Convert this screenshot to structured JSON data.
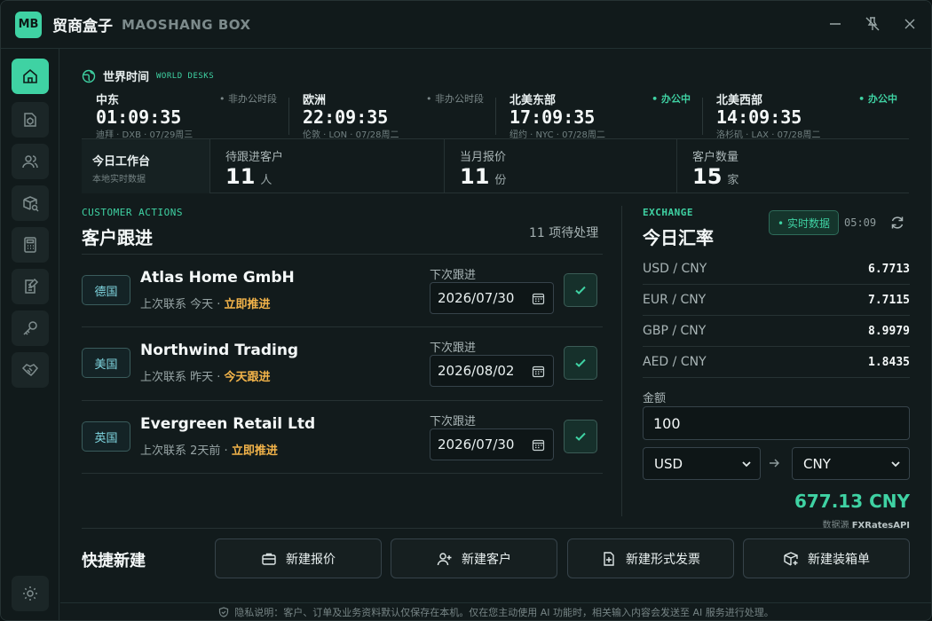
{
  "app": {
    "logo": "MB",
    "title": "贸商盒子",
    "subtitle": "MAOSHANG BOX"
  },
  "window_controls": [
    "minimize-icon",
    "unpin-icon",
    "close-icon"
  ],
  "sidebar": {
    "items": [
      {
        "icon": "home-icon",
        "active": true
      },
      {
        "icon": "box-document-icon",
        "active": false
      },
      {
        "icon": "users-icon",
        "active": false
      },
      {
        "icon": "box-search-icon",
        "active": false
      },
      {
        "icon": "calculator-icon",
        "active": false
      },
      {
        "icon": "edit-document-icon",
        "active": false
      },
      {
        "icon": "key-icon",
        "active": false
      },
      {
        "icon": "handshake-icon",
        "active": false
      }
    ],
    "bottom": {
      "icon": "gear-icon"
    }
  },
  "world_desks": {
    "title": "世界时间",
    "eyebrow": "WORLD DESKS",
    "clocks": [
      {
        "region": "中东",
        "status": "• 非办公时段",
        "open": false,
        "time": "01:09:35",
        "meta": "迪拜 · DXB · 07/29周三"
      },
      {
        "region": "欧洲",
        "status": "• 非办公时段",
        "open": false,
        "time": "22:09:35",
        "meta": "伦敦 · LON · 07/28周二"
      },
      {
        "region": "北美东部",
        "status": "• 办公中",
        "open": true,
        "time": "17:09:35",
        "meta": "纽约 · NYC · 07/28周二"
      },
      {
        "region": "北美西部",
        "status": "• 办公中",
        "open": true,
        "time": "14:09:35",
        "meta": "洛杉矶 · LAX · 07/28周二"
      }
    ]
  },
  "workbench": {
    "title": "今日工作台",
    "subtitle": "本地实时数据",
    "stats": [
      {
        "label": "待跟进客户",
        "value": "11",
        "unit": "人"
      },
      {
        "label": "当月报价",
        "value": "11",
        "unit": "份"
      },
      {
        "label": "客户数量",
        "value": "15",
        "unit": "家"
      }
    ]
  },
  "customer_actions": {
    "eyebrow": "CUSTOMER ACTIONS",
    "title": "客户跟进",
    "pending": "11 项待处理",
    "next_label": "下次跟进",
    "rows": [
      {
        "country": "德国",
        "name": "Atlas Home GmbH",
        "last_prefix": "上次联系 今天 · ",
        "action": "立即推进",
        "next_date": "2026/07/30"
      },
      {
        "country": "美国",
        "name": "Northwind Trading",
        "last_prefix": "上次联系 昨天 · ",
        "action": "今天跟进",
        "next_date": "2026/08/02"
      },
      {
        "country": "英国",
        "name": "Evergreen Retail Ltd",
        "last_prefix": "上次联系 2天前 · ",
        "action": "立即推进",
        "next_date": "2026/07/30"
      }
    ]
  },
  "exchange": {
    "eyebrow": "EXCHANGE",
    "title": "今日汇率",
    "live_label": "• 实时数据",
    "updated": "05:09",
    "rates": [
      {
        "pair": "USD / CNY",
        "rate": "6.7713"
      },
      {
        "pair": "EUR / CNY",
        "rate": "7.7115"
      },
      {
        "pair": "GBP / CNY",
        "rate": "8.9979"
      },
      {
        "pair": "AED / CNY",
        "rate": "1.8435"
      }
    ],
    "amount_label": "金额",
    "amount": "100",
    "from": "USD",
    "to": "CNY",
    "result": "677.13 CNY",
    "source_label": "数据源 ",
    "source": "FXRatesAPI"
  },
  "quick_create": {
    "title": "快捷新建",
    "buttons": [
      {
        "label": "新建报价",
        "icon": "briefcase-icon"
      },
      {
        "label": "新建客户",
        "icon": "add-user-icon"
      },
      {
        "label": "新建形式发票",
        "icon": "add-document-icon"
      },
      {
        "label": "新建装箱单",
        "icon": "box-add-icon"
      }
    ]
  },
  "footer": {
    "text": "隐私说明：客户、订单及业务资料默认仅保存在本机。仅在您主动使用 AI 功能时，相关输入内容会发送至 AI 服务进行处理。"
  },
  "colors": {
    "accent": "#3fd2a3",
    "warning": "#f3b44a",
    "background": "#121b1c",
    "border": "#263233"
  }
}
